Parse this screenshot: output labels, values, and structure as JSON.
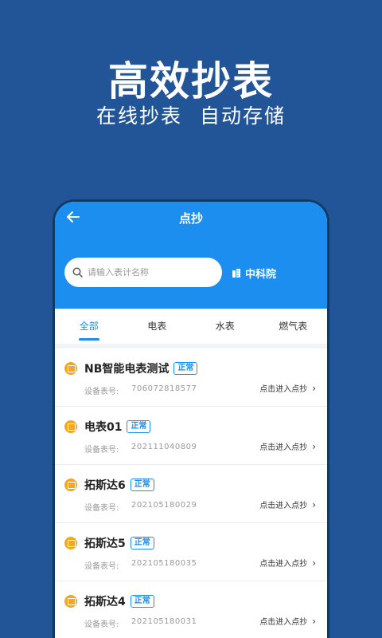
{
  "promo": {
    "headline": "高效抄表",
    "subline": "在线抄表  自动存储"
  },
  "header": {
    "title": "点抄",
    "back_icon": "arrow-left-icon"
  },
  "search": {
    "placeholder": "请输入表计名称",
    "value": ""
  },
  "org": {
    "label": "中科院",
    "icon": "building-icon"
  },
  "tabs": [
    {
      "label": "全部",
      "active": true
    },
    {
      "label": "电表",
      "active": false
    },
    {
      "label": "水表",
      "active": false
    },
    {
      "label": "燃气表",
      "active": false
    }
  ],
  "meters": [
    {
      "name": "NB智能电表测试",
      "status": "正常",
      "code_label": "设备表号:",
      "code": "706072818577",
      "action": "点击进入点抄"
    },
    {
      "name": "电表01",
      "status": "正常",
      "code_label": "设备表号:",
      "code": "202111040809",
      "action": "点击进入点抄"
    },
    {
      "name": "拓斯达6",
      "status": "正常",
      "code_label": "设备表号:",
      "code": "202105180029",
      "action": "点击进入点抄"
    },
    {
      "name": "拓斯达5",
      "status": "正常",
      "code_label": "设备表号:",
      "code": "202105180035",
      "action": "点击进入点抄"
    },
    {
      "name": "拓斯达4",
      "status": "正常",
      "code_label": "设备表号:",
      "code": "202105180031",
      "action": "点击进入点抄"
    }
  ],
  "colors": {
    "background": "#225598",
    "primary": "#1c8ef0",
    "meter_icon": "#f5a623"
  }
}
